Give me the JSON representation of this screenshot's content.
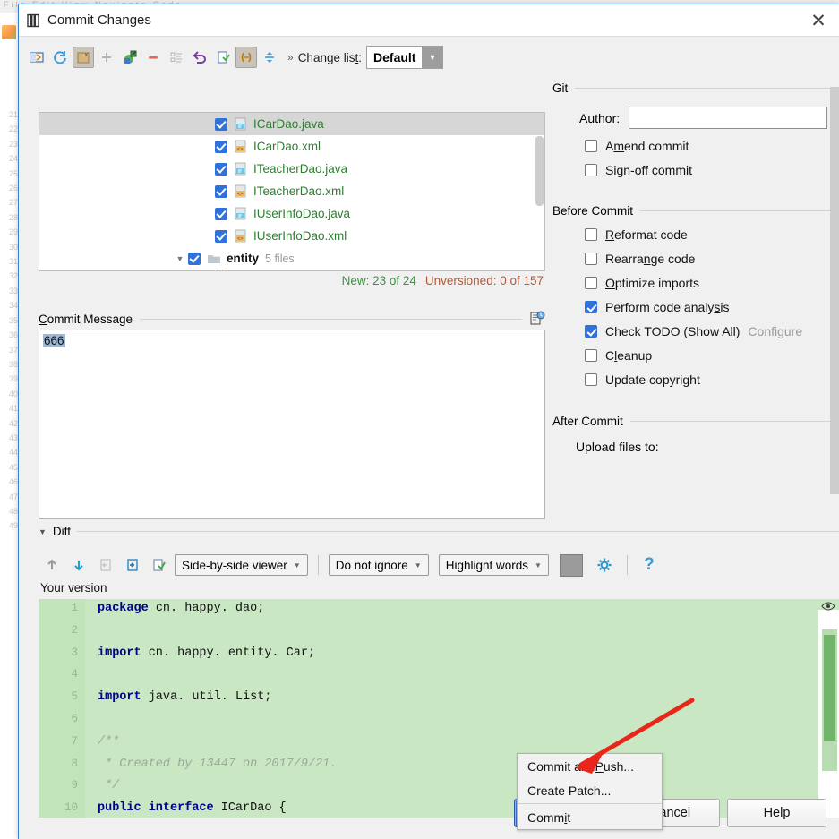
{
  "background": {
    "menubar_text": "File  Edit  View  Navigate  Code",
    "gutter_numbers": [
      "21",
      "22",
      "23",
      "24",
      "25",
      "26",
      "27",
      "28",
      "29",
      "30",
      "31",
      "32",
      "33",
      "34",
      "35",
      "36",
      "37",
      "38",
      "39",
      "40",
      "41",
      "42",
      "43",
      "44",
      "45",
      "46",
      "47",
      "48",
      "49"
    ]
  },
  "window": {
    "title": "Commit Changes",
    "icon": "commit-changes-icon",
    "close_label": "✕"
  },
  "toolbar": {
    "icons": [
      {
        "name": "show-diff-icon",
        "pressed": false
      },
      {
        "name": "refresh-icon",
        "pressed": false
      },
      {
        "name": "delete-changelist-icon",
        "pressed": true
      },
      {
        "name": "add-icon",
        "pressed": false
      },
      {
        "name": "move-to-changelist-icon",
        "pressed": false
      },
      {
        "name": "remove-icon",
        "pressed": false
      },
      {
        "name": "group-by-icon",
        "pressed": false
      },
      {
        "name": "rollback-icon",
        "pressed": false
      },
      {
        "name": "show-diff-preview-icon",
        "pressed": false
      },
      {
        "name": "collapse-icon",
        "pressed": true
      },
      {
        "name": "expand-all-icon",
        "pressed": false
      }
    ],
    "chevrons": "»",
    "changelist_label_pre": "Change lis",
    "changelist_label_underline": "t",
    "changelist_label_post": ":",
    "changelist_value": "Default",
    "changelist_arrow": "▼"
  },
  "file_list": {
    "rows": [
      {
        "name": "ICarDao.java",
        "icon": "java-file-icon",
        "checked": true,
        "selected": true,
        "type": "file"
      },
      {
        "name": "ICarDao.xml",
        "icon": "xml-file-icon",
        "checked": true,
        "selected": false,
        "type": "file"
      },
      {
        "name": "ITeacherDao.java",
        "icon": "java-file-icon",
        "checked": true,
        "selected": false,
        "type": "file"
      },
      {
        "name": "ITeacherDao.xml",
        "icon": "xml-file-icon",
        "checked": true,
        "selected": false,
        "type": "file"
      },
      {
        "name": "IUserInfoDao.java",
        "icon": "java-file-icon",
        "checked": true,
        "selected": false,
        "type": "file"
      },
      {
        "name": "IUserInfoDao.xml",
        "icon": "xml-file-icon",
        "checked": true,
        "selected": false,
        "type": "file"
      },
      {
        "name": "entity",
        "meta": "5 files",
        "icon": "folder-icon",
        "checked": true,
        "selected": false,
        "type": "folder",
        "expanded": true
      }
    ],
    "status_new": "New: 23 of 24",
    "status_unversioned": "Unversioned: 0 of 157"
  },
  "commit_message": {
    "label_underline": "C",
    "label_rest": "ommit Message",
    "value": "666",
    "placeholder": "",
    "icon": "message-history-icon"
  },
  "options": {
    "git": {
      "group_title": "Git",
      "author_label_underline": "A",
      "author_label_rest": "uthor:",
      "author_value": "",
      "checkboxes": [
        {
          "name": "amend-commit",
          "pre": "A",
          "u": "m",
          "post": "end commit",
          "checked": false
        },
        {
          "name": "sign-off-commit",
          "pre": "Si",
          "u": "g",
          "post": "n-off commit",
          "checked": false
        }
      ]
    },
    "before_commit": {
      "group_title": "Before Commit",
      "checkboxes": [
        {
          "name": "reformat-code",
          "pre": "",
          "u": "R",
          "post": "eformat code",
          "checked": false
        },
        {
          "name": "rearrange-code",
          "pre": "Rearra",
          "u": "n",
          "post": "ge code",
          "checked": false
        },
        {
          "name": "optimize-imports",
          "pre": "",
          "u": "O",
          "post": "ptimize imports",
          "checked": false
        },
        {
          "name": "perform-code-analysis",
          "pre": "Perform code analy",
          "u": "s",
          "post": "is",
          "checked": true
        },
        {
          "name": "check-todo",
          "pre": "Check TODO (Show All)",
          "u": "",
          "post": "",
          "checked": true,
          "link": "Configure"
        },
        {
          "name": "cleanup",
          "pre": "C",
          "u": "l",
          "post": "eanup",
          "checked": false
        },
        {
          "name": "update-copyright",
          "pre": "Update copyright",
          "u": "",
          "post": "",
          "checked": false
        }
      ]
    },
    "after_commit": {
      "group_title": "After Commit",
      "upload_label": "Upload files to:"
    }
  },
  "diff": {
    "section_title": "Diff",
    "section_tri": "▼",
    "toolbar_icons": [
      {
        "name": "previous-difference-icon"
      },
      {
        "name": "next-difference-icon"
      },
      {
        "name": "accept-left-icon"
      },
      {
        "name": "accept-right-icon"
      },
      {
        "name": "apply-changes-icon"
      }
    ],
    "viewer_select": "Side-by-side viewer",
    "ignore_select": "Do not ignore",
    "highlight_select": "Highlight words",
    "color_swatch": "#9b9b9b",
    "gear_icon": "settings-gear-icon",
    "help_icon": "?",
    "your_version_label": "Your version",
    "eye_icon": "preview-eye-icon"
  },
  "code": {
    "lines": [
      {
        "num": "1",
        "html": "<span class='kw'>package</span> cn. happy. dao;"
      },
      {
        "num": "2",
        "html": ""
      },
      {
        "num": "3",
        "html": "<span class='kw'>import</span> cn. happy. entity. Car;"
      },
      {
        "num": "4",
        "html": ""
      },
      {
        "num": "5",
        "html": "<span class='kw'>import</span> java. util. List;"
      },
      {
        "num": "6",
        "html": ""
      },
      {
        "num": "7",
        "html": "<span class='cmt'>/**</span>"
      },
      {
        "num": "8",
        "html": "<span class='cmt'> * Created by 13447 on 2017/9/21.</span>"
      },
      {
        "num": "9",
        "html": "<span class='cmt'> */</span>"
      },
      {
        "num": "10",
        "html": "<span class='kw'>public interface</span> ICarDao {"
      }
    ]
  },
  "context_menu": {
    "items": [
      {
        "name": "commit-and-push",
        "pre": "Commit and ",
        "u": "P",
        "post": "ush...",
        "separator_after": false
      },
      {
        "name": "create-patch",
        "pre": "Create Patch...",
        "u": "",
        "post": "",
        "separator_after": true
      },
      {
        "name": "commit",
        "pre": "Comm",
        "u": "i",
        "post": "t",
        "separator_after": false
      }
    ]
  },
  "buttons": {
    "commit": {
      "pre": "Comm",
      "u": "i",
      "post": "t"
    },
    "cancel": {
      "pre": "Cancel",
      "u": "",
      "post": ""
    },
    "help": {
      "pre": "Help",
      "u": "",
      "post": ""
    }
  },
  "colors": {
    "accent_blue": "#2f72d9",
    "primary_button": "#3465ba",
    "diff_green": "#c9e7c2",
    "status_new_green": "#3f8f43",
    "status_unversioned_brown": "#b05a38",
    "arrow_red": "#e8261a"
  }
}
